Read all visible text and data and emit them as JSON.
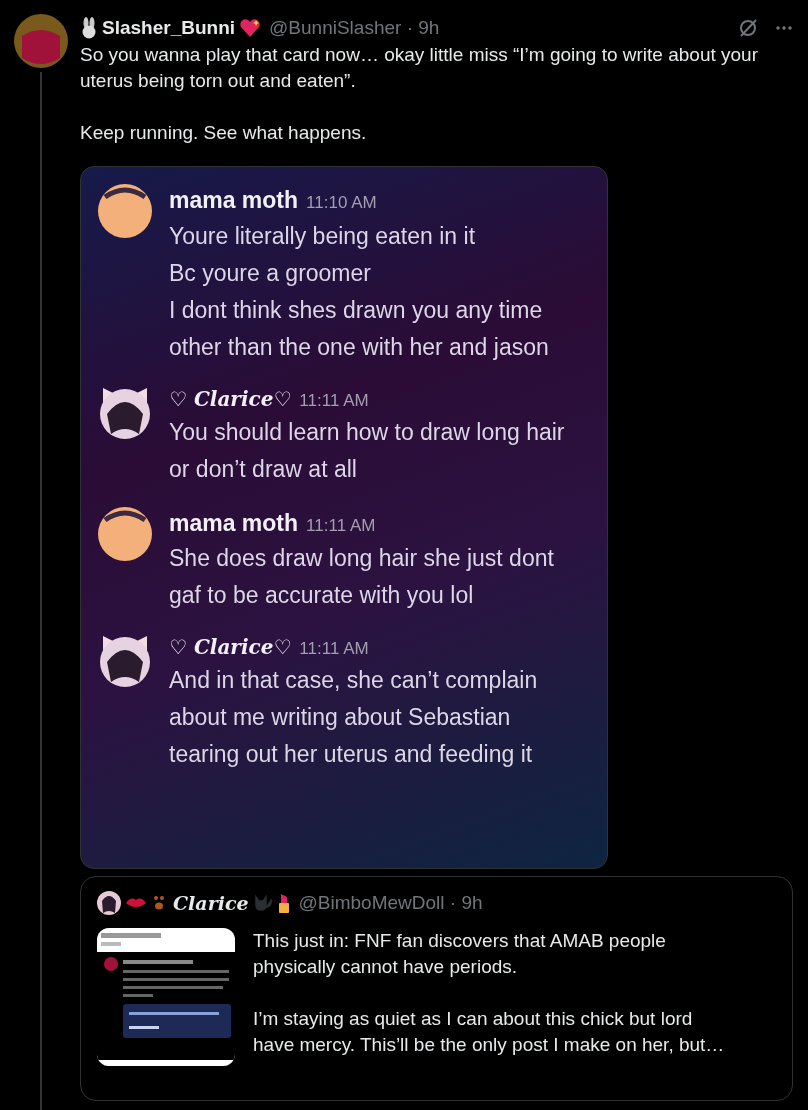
{
  "post": {
    "author": {
      "name": "Slasher_Bunni",
      "handle": "@BunniSlasher · 9h"
    },
    "paragraphs": [
      "So you wanna play that card now… okay little miss “I’m going to write about your uterus being torn out and eaten”.",
      "Keep running. See what happens."
    ],
    "chat_image": {
      "messages": [
        {
          "kind": "plain",
          "author": "mama moth",
          "time": "11:10 AM",
          "lines": [
            "Youre literally being eaten in it",
            "Bc youre a groomer",
            "I dont think shes drawn you any time other than the one with her and jason"
          ]
        },
        {
          "kind": "cat-ears",
          "author": "♡ Clarice♡",
          "time": "11:11 AM",
          "lines": [
            "You should learn how to draw long hair or don’t draw at all"
          ]
        },
        {
          "kind": "plain",
          "author": "mama moth",
          "time": "11:11 AM",
          "lines": [
            "She does draw long hair she just dont gaf to be accurate with you lol"
          ]
        },
        {
          "kind": "cat-ears",
          "author": "♡ Clarice♡",
          "time": "11:11 AM",
          "lines": [
            "And in that case, she can’t complain about me writing about Sebastian tearing out her uterus and feeding it"
          ]
        }
      ]
    },
    "quoted": {
      "author": "Clarice",
      "handle": "@BimboMewDoll · 9h",
      "thumbnail": {
        "kind": "picture"
      },
      "paragraphs": [
        "This just in: FNF fan discovers that AMAB people physically cannot have periods.",
        "I’m staying as quiet as I can about this chick but lord have mercy.  This’ll be the only post I make on her, but…"
      ]
    }
  }
}
